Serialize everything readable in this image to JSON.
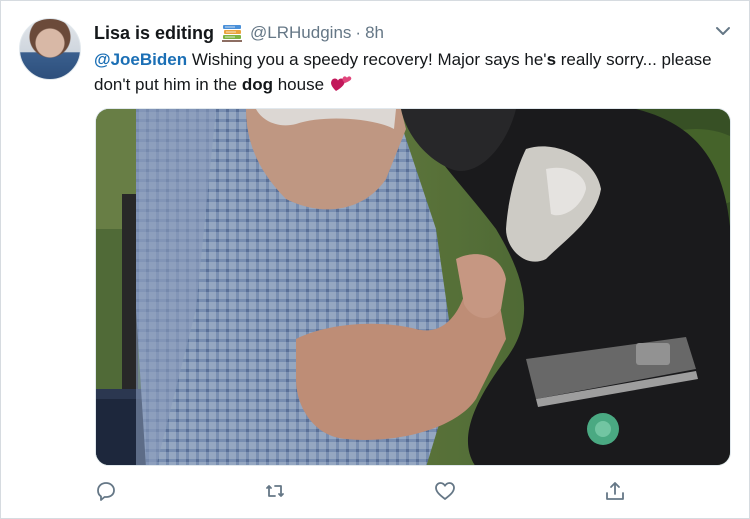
{
  "tweet": {
    "display_name": "Lisa is editing",
    "handle": "@LRHudgins",
    "separator": "·",
    "time": "8h",
    "text": {
      "mention": "@JoeBiden",
      "part1": " Wishing you a speedy recovery! Major says he'",
      "bold_s": "s",
      "part2": " really sorry... please don't put him in the ",
      "bold_dog": "dog",
      "part3": " house"
    }
  },
  "icons": {
    "name_emoji": "books-icon",
    "text_emoji": "two-hearts-icon",
    "menu": "chevron-down-icon",
    "reply": "reply-icon",
    "retweet": "retweet-icon",
    "like": "heart-icon",
    "share": "share-icon"
  },
  "colors": {
    "mention": "#1b6fb5",
    "muted": "#657786",
    "heart_emoji": "#c2185b"
  }
}
